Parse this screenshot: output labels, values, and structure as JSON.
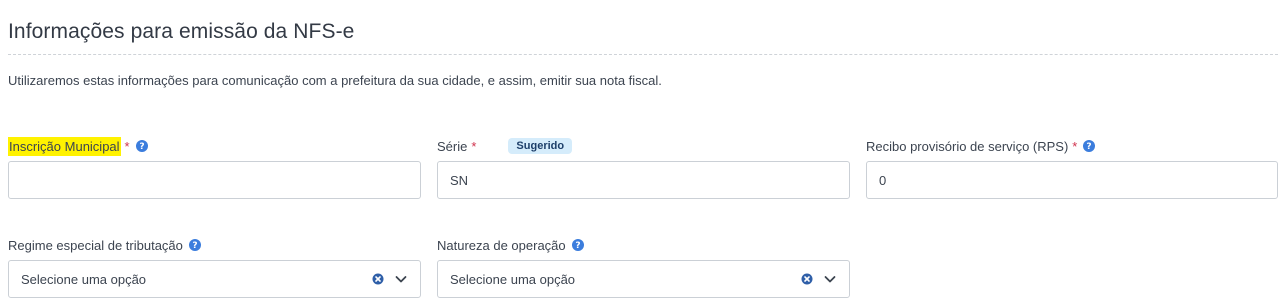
{
  "section": {
    "title": "Informações para emissão da NFS-e",
    "description": "Utilizaremos estas informações para comunicação com a prefeitura da sua cidade, e assim, emitir sua nota fiscal."
  },
  "fields": {
    "inscricao_municipal": {
      "label": "Inscrição Municipal",
      "required_mark": "*",
      "value": "",
      "placeholder": ""
    },
    "serie": {
      "label": "Série",
      "required_mark": "*",
      "badge": "Sugerido",
      "value": "SN"
    },
    "rps": {
      "label": "Recibo provisório de serviço (RPS)",
      "required_mark": "*",
      "value": "0"
    },
    "regime": {
      "label": "Regime especial de tributação",
      "selected": "Selecione uma opção"
    },
    "natureza": {
      "label": "Natureza de operação",
      "selected": "Selecione uma opção"
    }
  },
  "colors": {
    "help_icon": "#3b7ddd",
    "required": "#d0314c",
    "highlight": "#fff200",
    "badge_bg": "#d5ecfb",
    "clear_icon": "#2f5fa8"
  },
  "icons": {
    "help": "help-icon",
    "clear": "clear-icon",
    "chevron": "chevron-down-icon"
  }
}
